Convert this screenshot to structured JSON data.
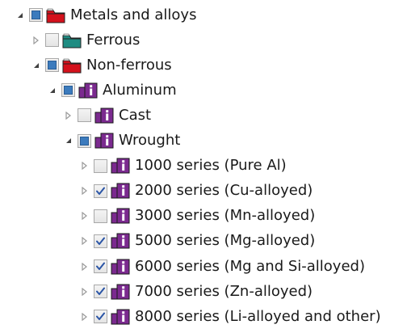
{
  "icon_legend": {
    "expanded": "expanded-arrow-icon",
    "collapsed": "collapsed-arrow-icon",
    "folder": "folder-icon",
    "material_info": "material-info-icon"
  },
  "colors": {
    "folder_red": "#d4111c",
    "folder_teal": "#1e8c82",
    "material_purple": "#7b2a8f",
    "partial_fill": "#3c7bbd"
  },
  "tree": [
    {
      "label": "Metals and alloys",
      "expanded": true,
      "check": "partial",
      "icon": "folder-icon",
      "color": "#d4111c"
    },
    {
      "label": "Ferrous",
      "expanded": false,
      "check": "unchecked",
      "icon": "folder-icon",
      "color": "#1e8c82"
    },
    {
      "label": "Non-ferrous",
      "expanded": true,
      "check": "partial",
      "icon": "folder-icon",
      "color": "#d4111c"
    },
    {
      "label": "Aluminum",
      "expanded": true,
      "check": "partial",
      "icon": "material-info-icon",
      "color": "#7b2a8f"
    },
    {
      "label": "Cast",
      "expanded": false,
      "check": "unchecked",
      "icon": "material-info-icon",
      "color": "#7b2a8f"
    },
    {
      "label": "Wrought",
      "expanded": true,
      "check": "partial",
      "icon": "material-info-icon",
      "color": "#7b2a8f"
    },
    {
      "label": "1000 series (Pure Al)",
      "expanded": false,
      "check": "unchecked",
      "icon": "material-info-icon",
      "color": "#7b2a8f"
    },
    {
      "label": "2000 series (Cu-alloyed)",
      "expanded": false,
      "check": "checked",
      "icon": "material-info-icon",
      "color": "#7b2a8f"
    },
    {
      "label": "3000 series (Mn-alloyed)",
      "expanded": false,
      "check": "unchecked",
      "icon": "material-info-icon",
      "color": "#7b2a8f"
    },
    {
      "label": "5000 series (Mg-alloyed)",
      "expanded": false,
      "check": "checked",
      "icon": "material-info-icon",
      "color": "#7b2a8f"
    },
    {
      "label": "6000 series (Mg and Si-alloyed)",
      "expanded": false,
      "check": "checked",
      "icon": "material-info-icon",
      "color": "#7b2a8f"
    },
    {
      "label": "7000 series (Zn-alloyed)",
      "expanded": false,
      "check": "checked",
      "icon": "material-info-icon",
      "color": "#7b2a8f"
    },
    {
      "label": "8000 series (Li-alloyed and other)",
      "expanded": false,
      "check": "checked",
      "icon": "material-info-icon",
      "color": "#7b2a8f"
    }
  ]
}
